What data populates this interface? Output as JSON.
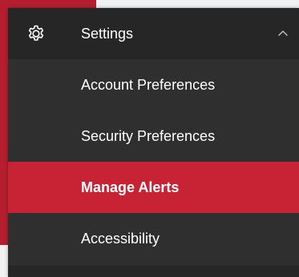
{
  "menu": {
    "header": {
      "label": "Settings",
      "icon": "gear-icon",
      "toggle_icon": "chevron-up-icon"
    },
    "items": [
      {
        "label": "Account Preferences",
        "active": false
      },
      {
        "label": "Security Preferences",
        "active": false
      },
      {
        "label": "Manage Alerts",
        "active": true
      },
      {
        "label": "Accessibility",
        "active": false
      }
    ]
  },
  "colors": {
    "menu_background": "#2f2f2f",
    "header_background": "#262626",
    "active_background": "#c72335",
    "text": "#ffffff",
    "page_accent": "#b41e2e"
  }
}
